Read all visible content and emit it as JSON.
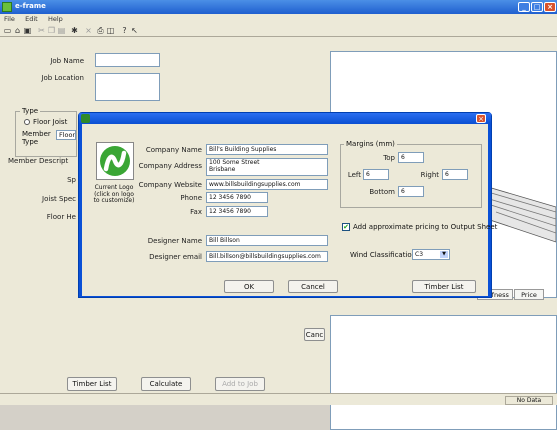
{
  "window": {
    "title": "e-frame"
  },
  "menu": [
    "File",
    "Edit",
    "Help"
  ],
  "toolbar_icons": [
    "new-icon",
    "open-icon",
    "save-icon",
    "cut-icon",
    "copy-icon",
    "paste-icon",
    "frame-icon",
    "delete-icon",
    "print-icon",
    "preview-icon",
    "help-icon",
    "whats-this-icon"
  ],
  "main": {
    "job_name_label": "Job Name",
    "job_location_label": "Job Location",
    "type_group_label": "Type",
    "type_option": "Floor Joist",
    "member_type_label": "Member Type",
    "member_type_value": "Floor J",
    "member_description_label": "Member Descript",
    "sp_label": "Sp",
    "joist_spec_label": "Joist Spec",
    "floor_ht_label": "Floor He",
    "stiffness_col": "Stiffness",
    "price_col": "Price",
    "cancel_button": "Canc",
    "timber_list_button": "Timber List",
    "calculate_button": "Calculate",
    "add_to_job_button": "Add to Job",
    "status_text": "No Data"
  },
  "dialog": {
    "logo_caption": "Current Logo (click on logo to customize)",
    "company_name_label": "Company Name",
    "company_name_value": "Bill's Building Supplies",
    "company_address_label": "Company Address",
    "company_address_line1": "100 Some Street",
    "company_address_line2": "Brisbane",
    "company_website_label": "Company Website",
    "company_website_value": "www.billsbuildingsupplies.com",
    "phone_label": "Phone",
    "phone_value": "12 3456 7890",
    "fax_label": "Fax",
    "fax_value": "12 3456 7890",
    "designer_name_label": "Designer Name",
    "designer_name_value": "Bill Billson",
    "designer_email_label": "Designer email",
    "designer_email_value": "Bill.billson@billsbuildingsupplies.com",
    "margins_label": "Margins (mm)",
    "top_label": "Top",
    "top_value": "6",
    "left_label": "Left",
    "left_value": "6",
    "right_label": "Right",
    "right_value": "6",
    "bottom_label": "Bottom",
    "bottom_value": "6",
    "pricing_checkbox_label": "Add approximate pricing to Output Sheet",
    "pricing_checked": true,
    "wind_label": "Wind Classification",
    "wind_value": "C3",
    "ok_button": "OK",
    "cancel_button": "Cancel",
    "timber_list_button": "Timber List"
  },
  "colors": {
    "title_blue": "#0a50d7",
    "logo_green": "#3aa635",
    "close_red": "#d9532c"
  }
}
